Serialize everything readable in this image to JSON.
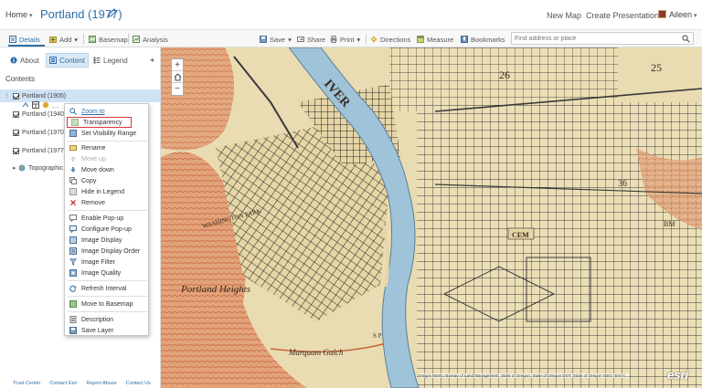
{
  "header": {
    "home": "Home",
    "title": "Portland (1977)",
    "links": {
      "new_map": "New Map",
      "create_presentation": "Create Presentation"
    },
    "user": "Aileen"
  },
  "toolbar": {
    "details": "Details",
    "add": "Add",
    "basemap": "Basemap",
    "analysis": "Analysis",
    "save": "Save",
    "share": "Share",
    "print": "Print",
    "directions": "Directions",
    "measure": "Measure",
    "bookmarks": "Bookmarks",
    "search_placeholder": "Find address or place"
  },
  "panel": {
    "tabs": {
      "about": "About",
      "content": "Content",
      "legend": "Legend"
    },
    "contents_label": "Contents",
    "layers": [
      {
        "name": "Portland (1905)",
        "checked": true
      },
      {
        "name": "Portland (1940)",
        "checked": true
      },
      {
        "name": "Portland (1970)",
        "checked": true
      },
      {
        "name": "Portland (1977)",
        "checked": true
      },
      {
        "name": "Topographic",
        "checked": false
      }
    ],
    "footer": [
      "Trust Center",
      "Contact Esri",
      "Report Abuse",
      "Contact Us"
    ]
  },
  "context_menu": {
    "items": [
      {
        "label": "Zoom to"
      },
      {
        "label": "Transparency"
      },
      {
        "label": "Set Visibility Range"
      },
      {
        "label": "Rename"
      },
      {
        "label": "Move up"
      },
      {
        "label": "Move down"
      },
      {
        "label": "Copy"
      },
      {
        "label": "Hide in Legend"
      },
      {
        "label": "Remove"
      },
      {
        "label": "Enable Pop-up"
      },
      {
        "label": "Configure Pop-up"
      },
      {
        "label": "Image Display"
      },
      {
        "label": "Image Display Order"
      },
      {
        "label": "Image Filter"
      },
      {
        "label": "Image Quality"
      },
      {
        "label": "Refresh Interval"
      },
      {
        "label": "Move to Basemap"
      },
      {
        "label": "Description"
      },
      {
        "label": "Save Layer"
      }
    ]
  },
  "map": {
    "labels": {
      "river": "IVER",
      "washington_park": "WASHINGTON PARK",
      "portland_heights": "Portland Heights",
      "marquam_gulch": "Marquam Gulch",
      "cem": "CEM",
      "n26": "26",
      "n36": "36",
      "n25": "25",
      "bm": "BM",
      "sp": "S P"
    },
    "attribution": "Oregon Metro, Bureau of Land Management, State of Oregon, State of Oregon DOT, State of Oregon GEO, Esri C...",
    "logo": "esri",
    "colors": {
      "paper": "#e9dbb0",
      "river": "#9fc3d8",
      "streets": "#2b2b2b",
      "hills": "#d9865a"
    }
  }
}
